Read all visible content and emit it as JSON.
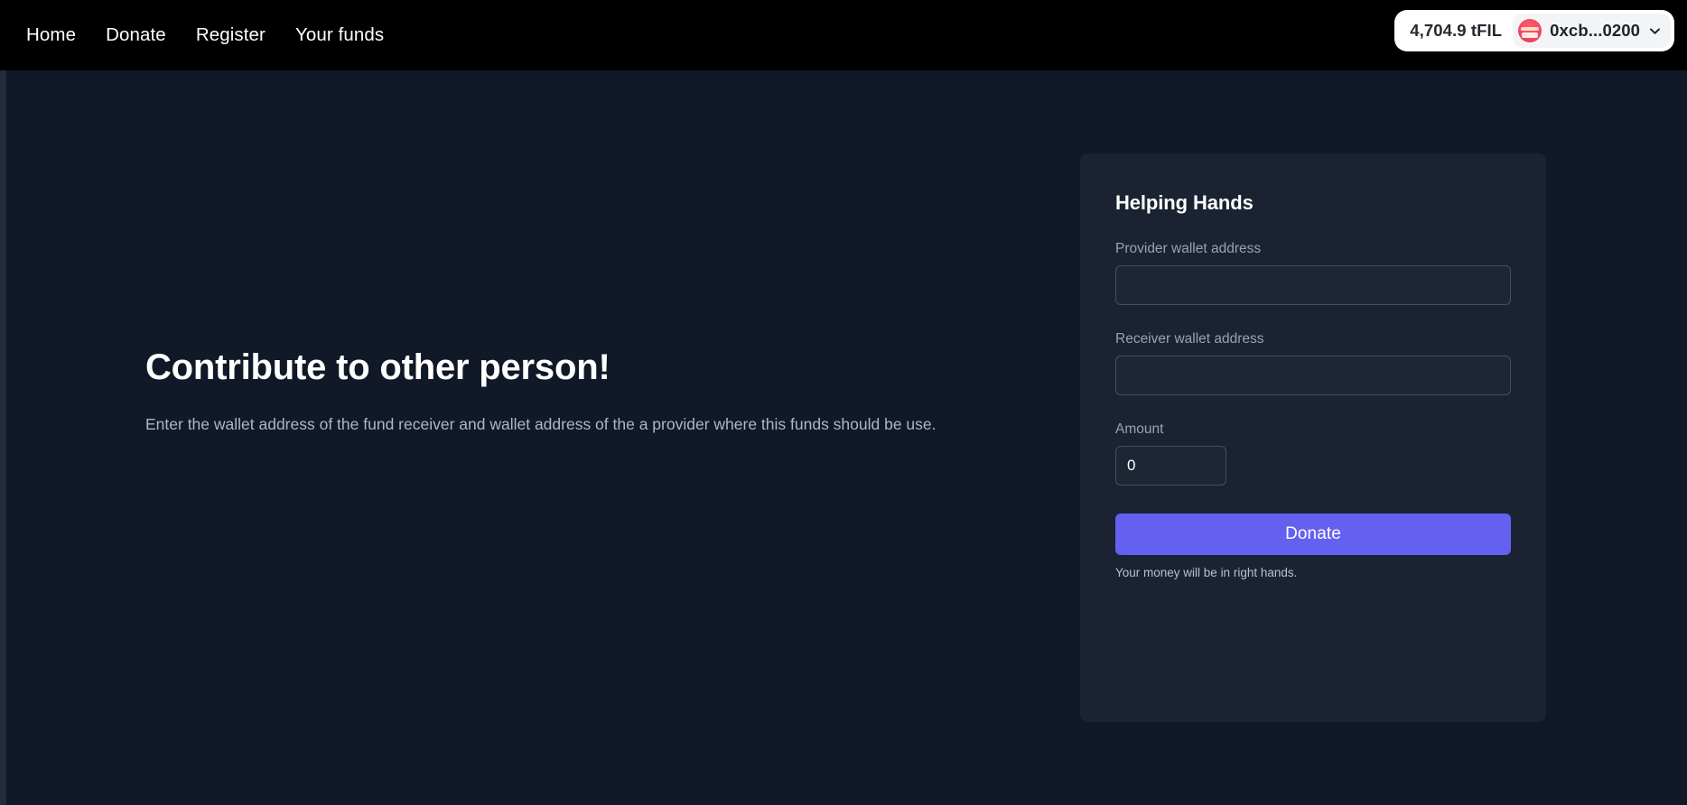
{
  "navbar": {
    "links": [
      {
        "label": "Home"
      },
      {
        "label": "Donate"
      },
      {
        "label": "Register"
      },
      {
        "label": "Your funds"
      }
    ],
    "wallet": {
      "balance": "4,704.9 tFIL",
      "address": "0xcb...0200",
      "avatar_icon": "account-avatar-icon",
      "chevron_icon": "chevron-down-icon"
    }
  },
  "hero": {
    "title": "Contribute to other person!",
    "description": "Enter the wallet address of the fund receiver and wallet address of the a provider where this funds should be use."
  },
  "card": {
    "title": "Helping Hands",
    "fields": {
      "provider": {
        "label": "Provider wallet address",
        "value": "",
        "placeholder": ""
      },
      "receiver": {
        "label": "Receiver wallet address",
        "value": "",
        "placeholder": ""
      },
      "amount": {
        "label": "Amount",
        "value": "0",
        "placeholder": "0"
      }
    },
    "donate_button": "Donate",
    "helper_text": "Your money will be in right hands."
  },
  "colors": {
    "page_background": "#111827",
    "navbar_background": "#000000",
    "card_background": "#1b2332",
    "accent": "#6461f0",
    "input_border": "#434e63",
    "muted_text": "#98a2b3",
    "avatar_pink": "#f4455f"
  }
}
